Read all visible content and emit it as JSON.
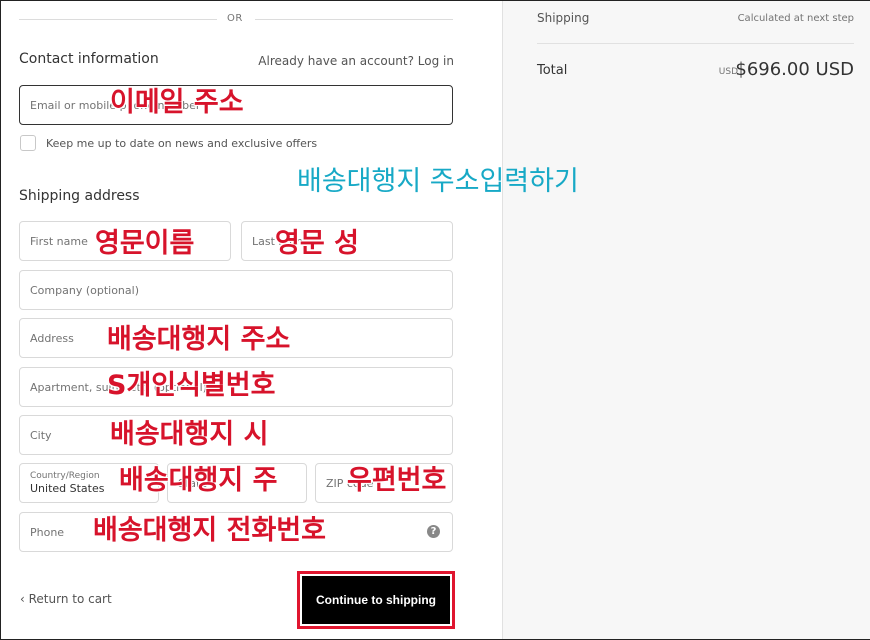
{
  "divider": {
    "or_text": "OR"
  },
  "contact": {
    "title": "Contact information",
    "login_prompt": "Already have an account? Log in",
    "email_placeholder": "Email or mobile phone number",
    "newsletter_label": "Keep me up to date on news and exclusive offers"
  },
  "shipping": {
    "title": "Shipping address",
    "first_name_placeholder": "First name",
    "last_name_placeholder": "Last name",
    "company_placeholder": "Company (optional)",
    "address_placeholder": "Address",
    "apartment_placeholder": "Apartment, suite, etc. (optional)",
    "city_placeholder": "City",
    "country_label": "Country/Region",
    "country_value": "United States",
    "state_placeholder": "State",
    "zip_placeholder": "ZIP code",
    "phone_placeholder": "Phone",
    "help_icon": "question-circle-icon"
  },
  "actions": {
    "return_label": "‹ Return to cart",
    "continue_label": "Continue to shipping"
  },
  "summary": {
    "shipping_label": "Shipping",
    "shipping_value": "Calculated at next step",
    "total_label": "Total",
    "currency": "USD",
    "total_value": "$696.00 USD"
  },
  "annotations": {
    "email": "이메일 주소",
    "heading": "배송대행지 주소입력하기",
    "first_name": "영문이름",
    "last_name": "영문 성",
    "address": "배송대행지 주소",
    "apartment": "S개인식별번호",
    "city": "배송대행지 시",
    "state": "배송대행지 주",
    "zip": "우편번호",
    "phone": "배송대행지 전화번호"
  },
  "colors": {
    "annotation_red": "#d7132b",
    "annotation_cyan": "#17a9c6",
    "button_black": "#000000",
    "highlight_border": "#e0152f"
  }
}
